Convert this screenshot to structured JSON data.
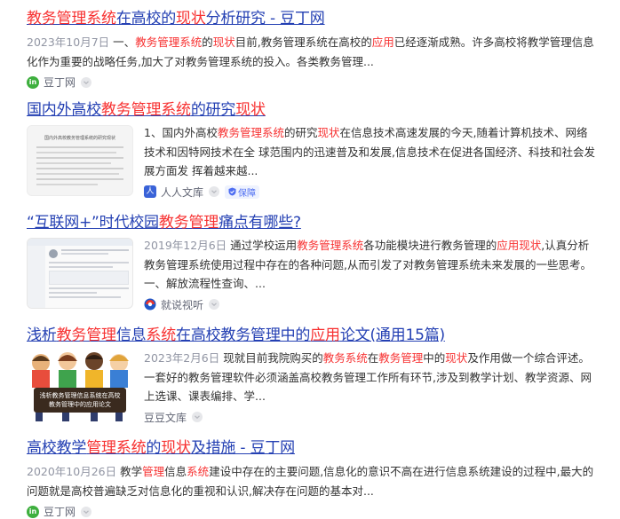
{
  "results": [
    {
      "title_parts": [
        {
          "t": "教务管理系统",
          "hl": true
        },
        {
          "t": "在高校的",
          "hl": false
        },
        {
          "t": "现状",
          "hl": true
        },
        {
          "t": "分析研究 - 豆丁网",
          "hl": false
        }
      ],
      "date": "2023年10月7日",
      "snippet_parts": [
        {
          "t": "一、",
          "hl": false
        },
        {
          "t": "教务管理系统",
          "hl": true
        },
        {
          "t": "的",
          "hl": false
        },
        {
          "t": "现状",
          "hl": true
        },
        {
          "t": "目前,教务管理系统在高校的",
          "hl": false
        },
        {
          "t": "应用",
          "hl": true
        },
        {
          "t": "已经逐渐成熟。许多高校将教学管理信息化作为重要的战略任务,加大了对教务管理系统的投入。各类教务管理...",
          "hl": false
        }
      ],
      "source": "豆丁网",
      "logo_text": "in"
    },
    {
      "title_parts": [
        {
          "t": "国内外高校",
          "hl": false
        },
        {
          "t": "教务管理系统",
          "hl": true
        },
        {
          "t": "的研究",
          "hl": false
        },
        {
          "t": "现状",
          "hl": true
        }
      ],
      "snippet_parts": [
        {
          "t": "1、国内外高校",
          "hl": false
        },
        {
          "t": "教务管理系统",
          "hl": true
        },
        {
          "t": "的研究",
          "hl": false
        },
        {
          "t": "现状",
          "hl": true
        },
        {
          "t": "在信息技术高速发展的今天,随着计算机技术、网络技术和因特网技术在全 球范围内的迅速普及和发展,信息技术在促进各国经济、科技和社会发展方面发 挥着越来越...",
          "hl": false
        }
      ],
      "source": "人人文库",
      "logo_text": "人",
      "badge": "保障",
      "thumb_title": "国内外高校教务管理系统的研究现状"
    },
    {
      "title_parts": [
        {
          "t": "“互联网+”时代校园",
          "hl": false
        },
        {
          "t": "教务管理",
          "hl": true
        },
        {
          "t": "痛点有哪些?",
          "hl": false
        }
      ],
      "date": "2019年12月6日",
      "snippet_parts": [
        {
          "t": "通过学校运用",
          "hl": false
        },
        {
          "t": "教务管理系统",
          "hl": true
        },
        {
          "t": "各功能模块进行教务管理的",
          "hl": false
        },
        {
          "t": "应用现状",
          "hl": true
        },
        {
          "t": ",认真分析教务管理系统使用过程中存在的各种问题,从而引发了对教务管理系统未来发展的一些思考。 一、解放流程性查询、...",
          "hl": false
        }
      ],
      "source": "就说视听"
    },
    {
      "title_parts": [
        {
          "t": "浅析",
          "hl": false
        },
        {
          "t": "教务管理",
          "hl": true
        },
        {
          "t": "信息",
          "hl": false
        },
        {
          "t": "系统",
          "hl": true
        },
        {
          "t": "在高校教务管理中的",
          "hl": false
        },
        {
          "t": "应用",
          "hl": true
        },
        {
          "t": "论文(通用15篇)",
          "hl": false
        }
      ],
      "date": "2023年2月6日",
      "snippet_parts": [
        {
          "t": "现就目前我院购买的",
          "hl": false
        },
        {
          "t": "教务系统",
          "hl": true
        },
        {
          "t": "在",
          "hl": false
        },
        {
          "t": "教务管理",
          "hl": true
        },
        {
          "t": "中的",
          "hl": false
        },
        {
          "t": "现状",
          "hl": true
        },
        {
          "t": "及作用做一个综合评述。 一套好的教务管理软件必须涵盖高校教务管理工作所有环节,涉及到教学计划、教学资源、网上选课、课表编排、学...",
          "hl": false
        }
      ],
      "source": "豆豆文库",
      "thumb_caption": "浅析教务管理信息系统在高校教务管理中的应用论文"
    },
    {
      "title_parts": [
        {
          "t": "高校教学",
          "hl": false
        },
        {
          "t": "管理系统",
          "hl": true
        },
        {
          "t": "的",
          "hl": false
        },
        {
          "t": "现状",
          "hl": true
        },
        {
          "t": "及措施 - 豆丁网",
          "hl": false
        }
      ],
      "date": "2020年10月26日",
      "snippet_parts": [
        {
          "t": "教学",
          "hl": false
        },
        {
          "t": "管理",
          "hl": true
        },
        {
          "t": "信息",
          "hl": false
        },
        {
          "t": "系统",
          "hl": true
        },
        {
          "t": "建设中存在的主要问题,信息化的意识不高在进行信息系统建设的过程中,最大的问题就是高校普遍缺乏对信息化的重视和认识,解决存在问题的基本对...",
          "hl": false
        }
      ],
      "source": "豆丁网",
      "logo_text": "in"
    }
  ],
  "colors": {
    "link": "#2440b3",
    "highlight": "#f73131",
    "meta": "#9195a3",
    "douding_logo": "#3eaf3e",
    "renren_logo": "#3a63d8"
  }
}
